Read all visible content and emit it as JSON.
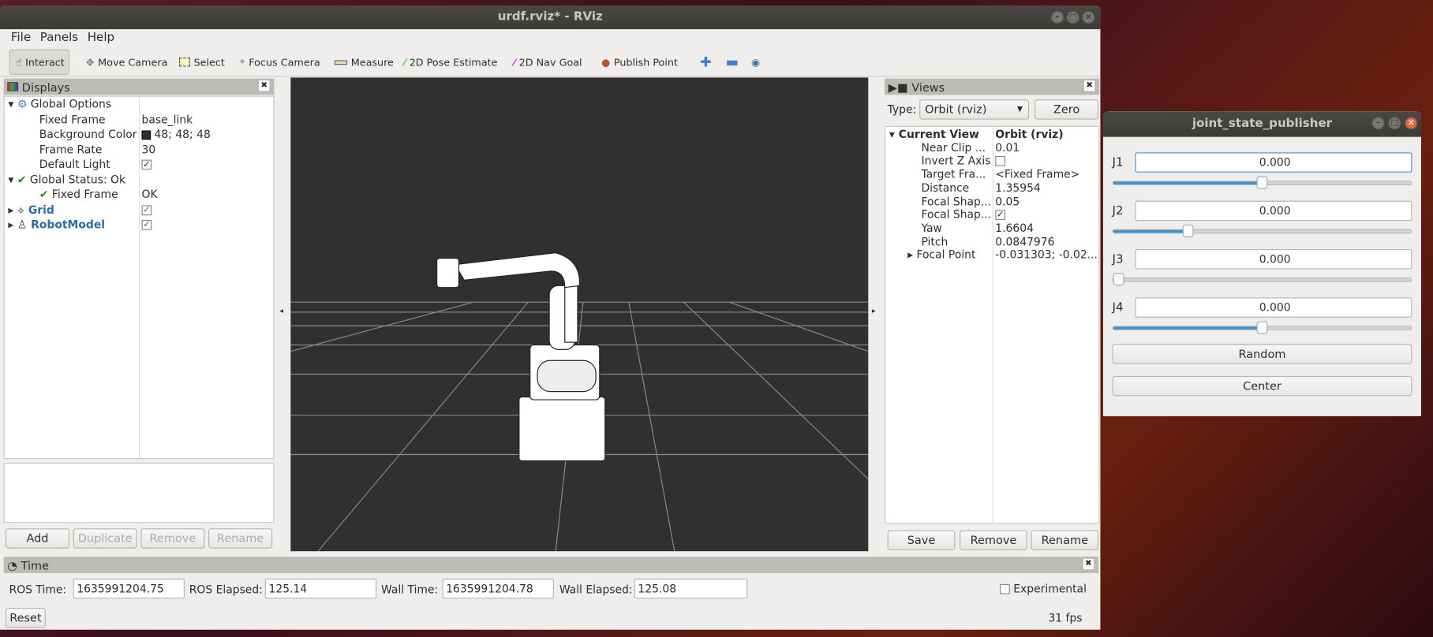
{
  "rviz": {
    "title": "urdf.rviz* - RViz",
    "menu": [
      "File",
      "Panels",
      "Help"
    ],
    "toolbar": [
      {
        "label": "Interact",
        "icon": "hand-pointer-icon",
        "active": true
      },
      {
        "label": "Move Camera",
        "icon": "move-camera-icon"
      },
      {
        "label": "Select",
        "icon": "select-box-icon"
      },
      {
        "label": "Focus Camera",
        "icon": "focus-camera-icon"
      },
      {
        "label": "Measure",
        "icon": "ruler-icon"
      },
      {
        "label": "2D Pose Estimate",
        "icon": "green-arrow-icon"
      },
      {
        "label": "2D Nav Goal",
        "icon": "magenta-arrow-icon"
      },
      {
        "label": "Publish Point",
        "icon": "map-pin-icon"
      }
    ],
    "displays": {
      "title": "Displays",
      "rows": [
        {
          "label": "Global Options",
          "value": ""
        },
        {
          "label": "Fixed Frame",
          "value": "base_link"
        },
        {
          "label": "Background Color",
          "value": "48; 48; 48"
        },
        {
          "label": "Frame Rate",
          "value": "30"
        },
        {
          "label": "Default Light",
          "value": "✓"
        },
        {
          "label": "Global Status: Ok",
          "value": ""
        },
        {
          "label": "Fixed Frame",
          "value": "OK"
        },
        {
          "label": "Grid",
          "value": "✓"
        },
        {
          "label": "RobotModel",
          "value": "✓"
        }
      ],
      "buttons": {
        "add": "Add",
        "duplicate": "Duplicate",
        "remove": "Remove",
        "rename": "Rename"
      }
    },
    "views": {
      "title": "Views",
      "type_label": "Type:",
      "type_value": "Orbit (rviz)",
      "zero": "Zero",
      "rows": [
        {
          "label": "Current View",
          "value": "Orbit (rviz)"
        },
        {
          "label": "Near Clip ...",
          "value": "0.01"
        },
        {
          "label": "Invert Z Axis",
          "value": ""
        },
        {
          "label": "Target Fra...",
          "value": "<Fixed Frame>"
        },
        {
          "label": "Distance",
          "value": "1.35954"
        },
        {
          "label": "Focal Shap...",
          "value": "0.05"
        },
        {
          "label": "Focal Shap...",
          "value": "✓"
        },
        {
          "label": "Yaw",
          "value": "1.6604"
        },
        {
          "label": "Pitch",
          "value": "0.0847976"
        },
        {
          "label": "Focal Point",
          "value": "-0.031303; -0.02..."
        }
      ],
      "buttons": {
        "save": "Save",
        "remove": "Remove",
        "rename": "Rename"
      }
    },
    "time": {
      "title": "Time",
      "ros_time_label": "ROS Time:",
      "ros_time": "1635991204.75",
      "ros_elapsed_label": "ROS Elapsed:",
      "ros_elapsed": "125.14",
      "wall_time_label": "Wall Time:",
      "wall_time": "1635991204.78",
      "wall_elapsed_label": "Wall Elapsed:",
      "wall_elapsed": "125.08",
      "experimental": "Experimental",
      "reset": "Reset",
      "fps": "31 fps"
    },
    "colors": {
      "viewport_bg": "#303030",
      "slider_fill": "#3d8fd0"
    }
  },
  "jsp": {
    "title": "joint_state_publisher",
    "joints": [
      {
        "name": "J1",
        "value": "0.000",
        "slider": 0.5
      },
      {
        "name": "J2",
        "value": "0.000",
        "slider": 0.25
      },
      {
        "name": "J3",
        "value": "0.000",
        "slider": 0.0
      },
      {
        "name": "J4",
        "value": "0.000",
        "slider": 0.5
      }
    ],
    "random": "Random",
    "center": "Center"
  }
}
